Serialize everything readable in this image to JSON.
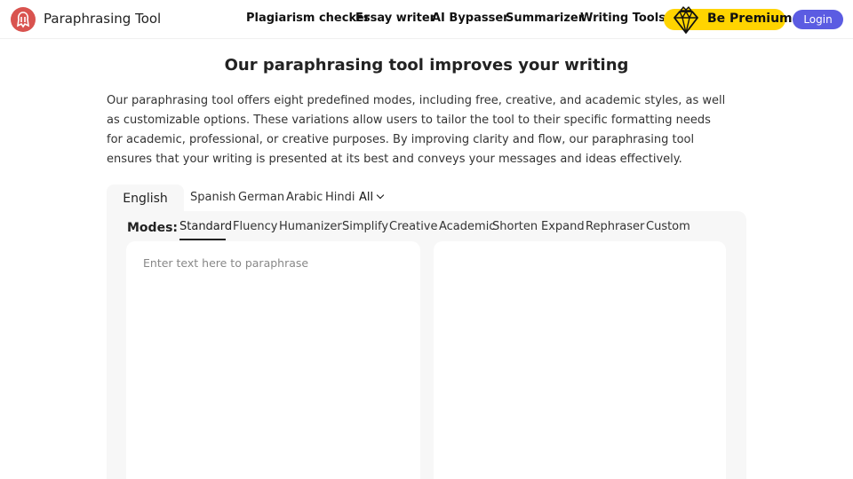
{
  "header": {
    "brand": "Paraphrasing Tool",
    "nav": [
      "Plagiarism checker",
      "Essay writer",
      "AI Bypasser",
      "Summarizer",
      "Writing Tools"
    ],
    "premium_label": "Be Premium",
    "login_label": "Login"
  },
  "hero": {
    "title": "Our paraphrasing tool improves your writing",
    "description": "Our paraphrasing tool offers eight predefined modes, including free, creative, and academic styles, as well as customizable options. These variations allow users to tailor the tool to their specific formatting needs for academic, professional, or creative purposes. By improving clarity and flow, our paraphrasing tool ensures that your writing is presented at its best and conveys your messages and ideas effectively."
  },
  "languages": {
    "active": "English",
    "items": [
      "Spanish",
      "German",
      "Arabic",
      "Hindi"
    ],
    "all_label": "All"
  },
  "modes": {
    "label": "Modes:",
    "items": [
      "Standard",
      "Fluency",
      "Humanizer",
      "Simplify",
      "Creative",
      "Academic",
      "Shorten",
      "Expand",
      "Rephraser",
      "Custom"
    ],
    "active_index": 0
  },
  "editor": {
    "input_value": "",
    "input_placeholder": "Enter text here to paraphrase",
    "output_value": ""
  },
  "colors": {
    "logo": "#d9534f",
    "premium": "#ffd400",
    "login": "#5b5ce2",
    "panel": "#f7f7f7"
  },
  "icons": {
    "logo": "app-logo-icon",
    "premium": "diamond-crown-icon",
    "all_dropdown": "chevron-down-icon"
  }
}
